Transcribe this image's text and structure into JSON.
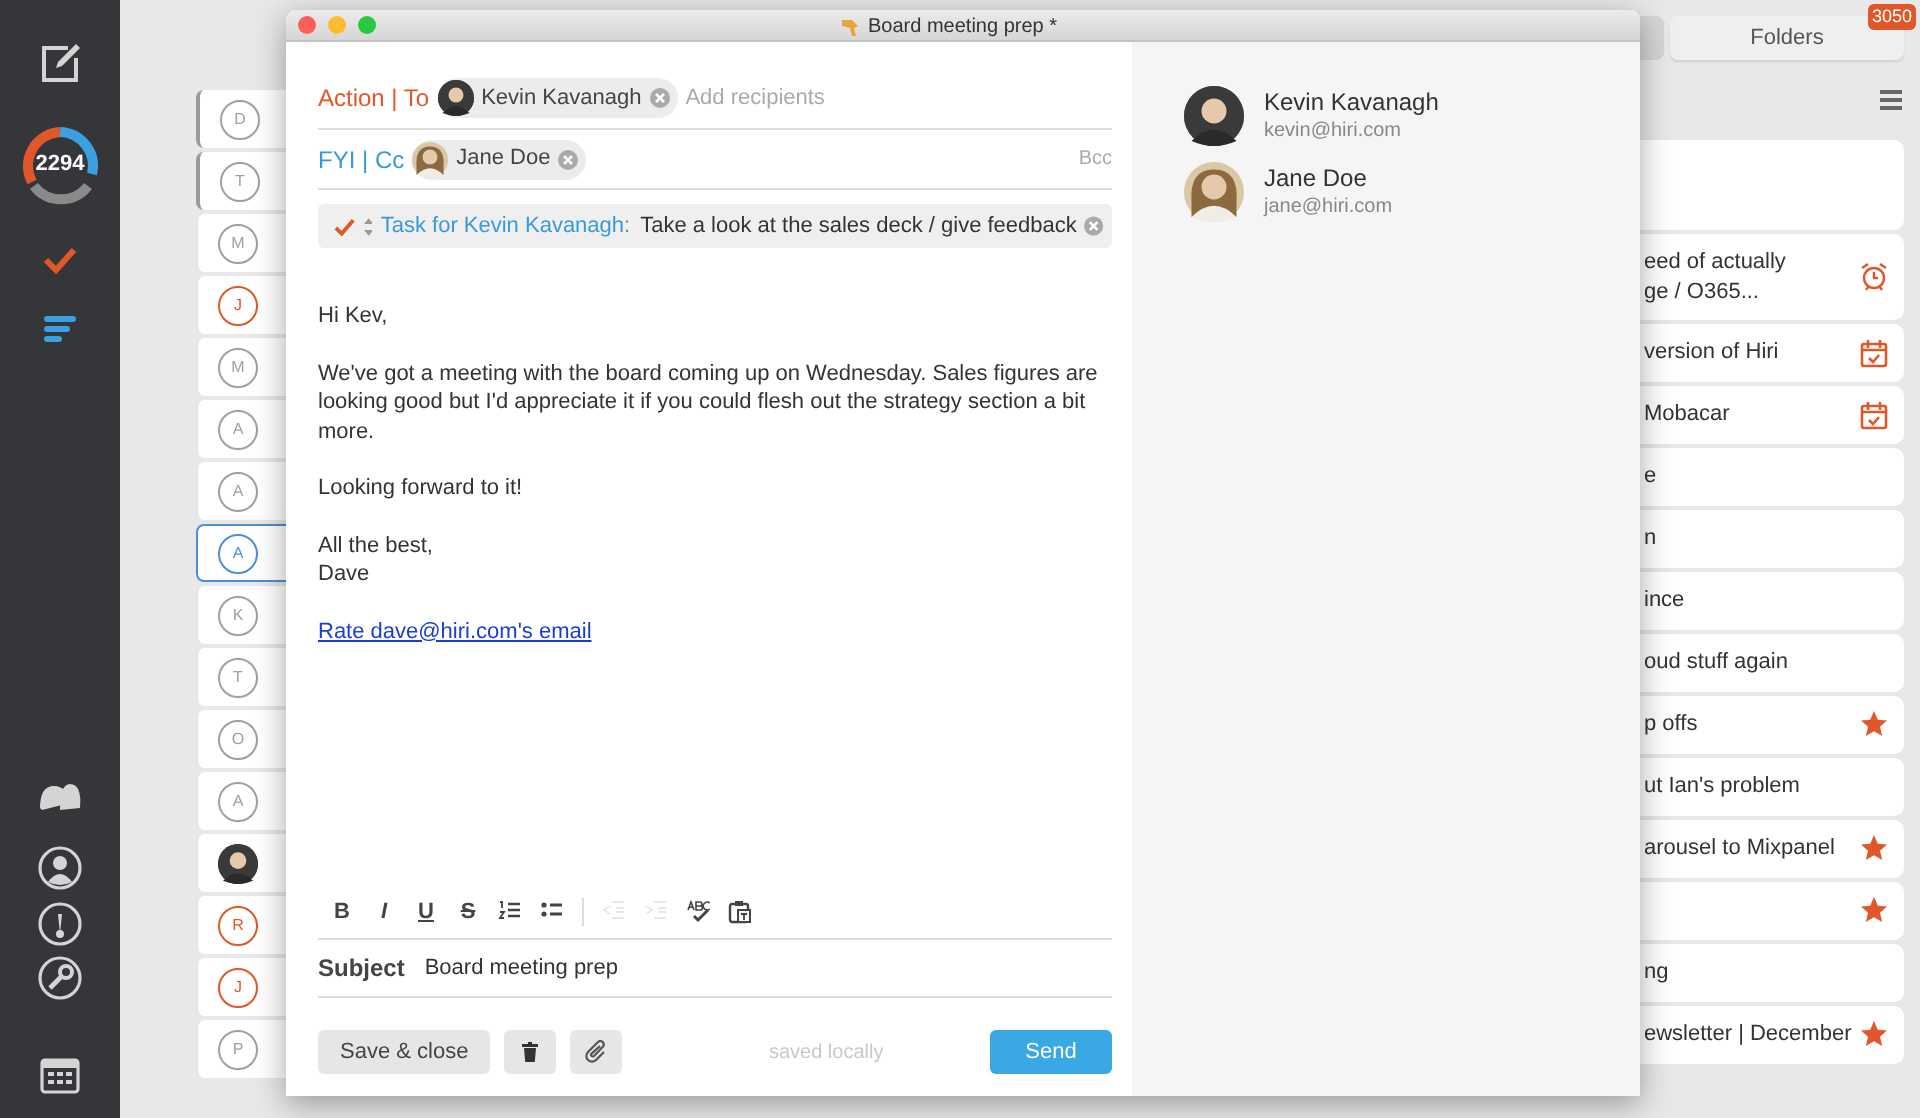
{
  "sidebar": {
    "unread_count": "2294"
  },
  "message_list": {
    "rows": [
      {
        "kind": "initial",
        "initial": "D",
        "unread": true,
        "selected": false,
        "color": "#a0a0a0"
      },
      {
        "kind": "initial",
        "initial": "T",
        "unread": true,
        "selected": false,
        "color": "#a0a0a0"
      },
      {
        "kind": "initial",
        "initial": "M",
        "unread": false,
        "selected": false,
        "color": "#a0a0a0"
      },
      {
        "kind": "initial",
        "initial": "J",
        "unread": false,
        "selected": false,
        "color": "#e0582a"
      },
      {
        "kind": "initial",
        "initial": "M",
        "unread": false,
        "selected": false,
        "color": "#a0a0a0"
      },
      {
        "kind": "initial",
        "initial": "A",
        "unread": false,
        "selected": false,
        "color": "#a0a0a0"
      },
      {
        "kind": "initial",
        "initial": "A",
        "unread": false,
        "selected": false,
        "color": "#a0a0a0"
      },
      {
        "kind": "initial",
        "initial": "A",
        "unread": false,
        "selected": true,
        "color": "#4a8fd8"
      },
      {
        "kind": "initial",
        "initial": "K",
        "unread": false,
        "selected": false,
        "color": "#a0a0a0"
      },
      {
        "kind": "initial",
        "initial": "T",
        "unread": false,
        "selected": false,
        "color": "#a0a0a0"
      },
      {
        "kind": "initial",
        "initial": "O",
        "unread": false,
        "selected": false,
        "color": "#a0a0a0"
      },
      {
        "kind": "initial",
        "initial": "A",
        "unread": false,
        "selected": false,
        "color": "#a0a0a0"
      },
      {
        "kind": "photo",
        "unread": false,
        "selected": false
      },
      {
        "kind": "initial",
        "initial": "R",
        "unread": false,
        "selected": false,
        "color": "#e0582a"
      },
      {
        "kind": "initial",
        "initial": "J",
        "unread": false,
        "selected": false,
        "color": "#e0582a"
      },
      {
        "kind": "initial",
        "initial": "P",
        "unread": false,
        "selected": false,
        "color": "#a0a0a0"
      }
    ]
  },
  "task_list": {
    "folders_tab": {
      "label": "Folders",
      "badge": "3050"
    },
    "rows": [
      {
        "kind": "search"
      },
      {
        "kind": "reminder",
        "lines": [
          "eed of actually",
          "ge / O365..."
        ]
      },
      {
        "kind": "event",
        "lines": [
          "version of Hiri"
        ]
      },
      {
        "kind": "event",
        "lines": [
          "Mobacar"
        ]
      },
      {
        "kind": "plain",
        "lines": [
          "e"
        ]
      },
      {
        "kind": "plain",
        "lines": [
          "n"
        ]
      },
      {
        "kind": "plain",
        "lines": [
          "ince"
        ]
      },
      {
        "kind": "plain",
        "lines": [
          "oud stuff again"
        ]
      },
      {
        "kind": "starred",
        "lines": [
          "p offs"
        ]
      },
      {
        "kind": "plain",
        "lines": [
          "ut Ian's problem"
        ]
      },
      {
        "kind": "starred",
        "lines": [
          "arousel to Mixpanel"
        ]
      },
      {
        "kind": "starred"
      },
      {
        "kind": "plain",
        "lines": [
          "ng"
        ]
      },
      {
        "kind": "starred",
        "lines": [
          "ewsletter | December"
        ]
      }
    ]
  },
  "compose": {
    "window": {
      "title": "Board meeting prep *"
    },
    "to": {
      "label": "Action | To",
      "recipients": [
        "Kevin Kavanagh"
      ],
      "placeholder": "Add recipients"
    },
    "cc": {
      "label": "FYI | Cc",
      "recipients": [
        "Jane Doe"
      ],
      "bcc": "Bcc"
    },
    "task": {
      "label": "Task for Kevin Kavanagh:",
      "text": "Take a look at the sales deck / give feedback"
    },
    "body": [
      "Hi Kev,",
      "We've got a meeting with the board coming up on Wednesday. Sales figures are looking good but I'd appreciate it if you could flesh out the strategy section a bit more.",
      "Looking forward to it!",
      "All the best,\nDave"
    ],
    "rating_link": "Rate dave@hiri.com's email",
    "toolbar": [
      {
        "kind": "bold",
        "label": "B",
        "disabled": false
      },
      {
        "kind": "italic",
        "label": "I",
        "disabled": false
      },
      {
        "kind": "underline",
        "label": "U",
        "disabled": false
      },
      {
        "kind": "strike",
        "label": "S",
        "disabled": false
      },
      {
        "kind": "numbered",
        "disabled": false
      },
      {
        "kind": "bullets",
        "disabled": false
      },
      {
        "kind": "outdent",
        "disabled": true
      },
      {
        "kind": "indent",
        "disabled": true
      },
      {
        "kind": "spellcheck",
        "disabled": false
      },
      {
        "kind": "paste",
        "disabled": false
      }
    ],
    "subject": {
      "label": "Subject",
      "value": "Board meeting prep"
    },
    "buttons": {
      "save": "Save & close",
      "status": "saved locally",
      "send": "Send"
    }
  },
  "contacts": [
    {
      "name": "Kevin Kavanagh",
      "email": "kevin@hiri.com",
      "kind": "man"
    },
    {
      "name": "Jane Doe",
      "email": "jane@hiri.com",
      "kind": "woman"
    }
  ]
}
